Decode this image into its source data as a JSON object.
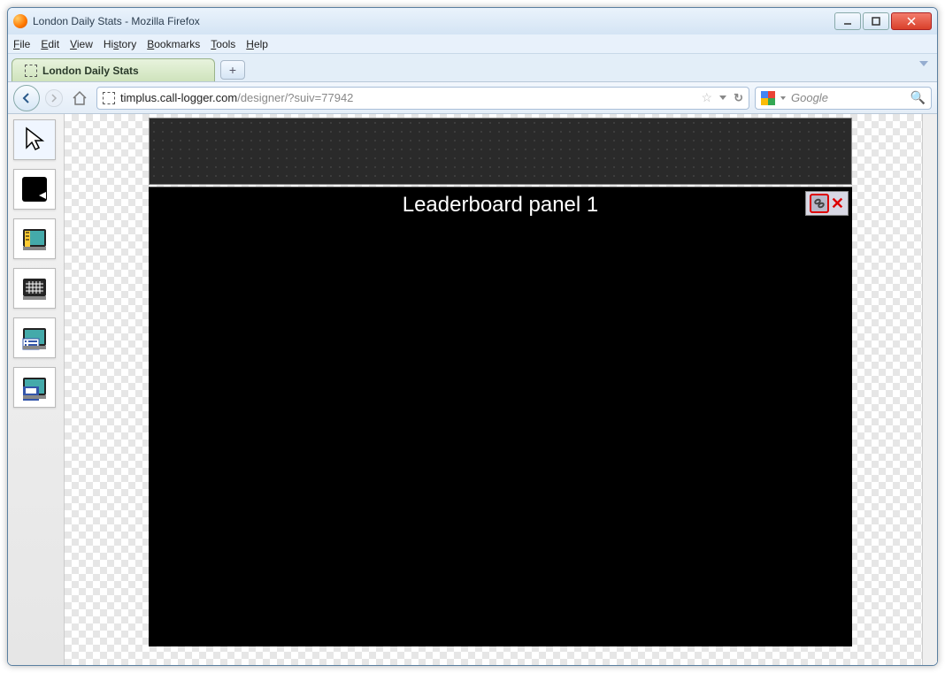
{
  "window": {
    "title": "London Daily Stats - Mozilla Firefox"
  },
  "menu": {
    "file": "File",
    "edit": "Edit",
    "view": "View",
    "history": "History",
    "bookmarks": "Bookmarks",
    "tools": "Tools",
    "help": "Help"
  },
  "tab": {
    "label": "London Daily Stats",
    "newtab": "+"
  },
  "url": {
    "host": "timplus.call-logger.com",
    "path": "/designer/?suiv=77942"
  },
  "search": {
    "placeholder": "Google"
  },
  "panel": {
    "title": "Leaderboard panel 1",
    "close": "✕"
  },
  "toolbar_icons": {
    "pointer": "pointer-tool",
    "run": "run-tool",
    "ruler": "ruler-tool",
    "grid": "grid-tool",
    "list": "list-tool",
    "save": "save-tool"
  }
}
